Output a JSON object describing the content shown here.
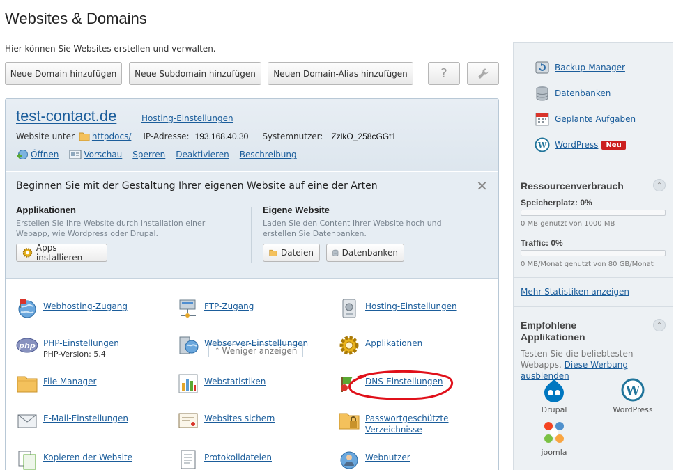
{
  "page": {
    "title": "Websites & Domains",
    "intro": "Hier können Sie Websites erstellen und verwalten."
  },
  "toolbar": {
    "add_domain": "Neue Domain hinzufügen",
    "add_subdomain": "Neue Subdomain hinzufügen",
    "add_alias": "Neuen Domain-Alias hinzufügen",
    "help_icon": "?",
    "tools_icon": "wrench-icon"
  },
  "site": {
    "domain": "test-contact.de",
    "hosting_link": "Hosting-Einstellungen",
    "website_prefix": "Website unter",
    "docroot": "httpdocs/",
    "ip_label": "IP-Adresse:",
    "ip": "193.168.40.30",
    "user_label": "Systemnutzer:",
    "user": "ZzlkO_258cGGt1",
    "actions": [
      "Öffnen",
      "Vorschau",
      "Sperren",
      "Deaktivieren",
      "Beschreibung"
    ]
  },
  "start": {
    "title": "Beginnen Sie mit der Gestaltung Ihrer eigenen Website auf eine der Arten",
    "close": "✕",
    "apps_title": "Applikationen",
    "apps_desc": "Erstellen Sie Ihre Website durch Installation einer Webapp, wie Wordpress oder Drupal.",
    "apps_button": "Apps installieren",
    "own_title": "Eigene Website",
    "own_desc": "Laden Sie den Content Ihrer Website hoch und erstellen Sie Datenbanken.",
    "files_button": "Dateien",
    "db_button": "Datenbanken",
    "less": "Weniger anzeigen"
  },
  "grid": [
    {
      "label": "Webhosting-Zugang"
    },
    {
      "label": "FTP-Zugang"
    },
    {
      "label": "Hosting-Einstellungen"
    },
    {
      "label": "PHP-Einstellungen",
      "sub": "PHP-Version: 5.4"
    },
    {
      "label": "Webserver-Einstellungen"
    },
    {
      "label": "Applikationen"
    },
    {
      "label": "File Manager"
    },
    {
      "label": "Webstatistiken"
    },
    {
      "label": "DNS-Einstellungen"
    },
    {
      "label": "E-Mail-Einstellungen"
    },
    {
      "label": "Websites sichern"
    },
    {
      "label": "Passwortgeschützte",
      "label2": "Verzeichnisse"
    },
    {
      "label": "Kopieren der Website"
    },
    {
      "label": "Protokolldateien"
    },
    {
      "label": "Webnutzer"
    }
  ],
  "sidebar": {
    "links": [
      {
        "label": "Backup-Manager"
      },
      {
        "label": "Datenbanken"
      },
      {
        "label": "Geplante Aufgaben"
      },
      {
        "label": "WordPress",
        "badge": "Neu"
      }
    ],
    "resources": {
      "title": "Ressourcenverbrauch",
      "disk_label": "Speicherplatz: 0%",
      "disk_fraction": 0.0,
      "disk_note": "0 MB genutzt von 1000 MB",
      "traffic_label": "Traffic: 0%",
      "traffic_fraction": 0.0,
      "traffic_note": "0 MB/Monat genutzt von 80 GB/Monat",
      "more": "Mehr Statistiken anzeigen"
    },
    "recommended": {
      "title_line1": "Empfohlene",
      "title_line2": "Applikationen",
      "desc": "Testen Sie die beliebtesten",
      "desc2": "Webapps.",
      "hide_link": "Diese Werbung ausblenden",
      "apps": [
        "Drupal",
        "WordPress",
        "joomla"
      ]
    }
  },
  "colors": {
    "link": "#1b5d9b",
    "badge": "#cc1f1f",
    "highlight": "#e0101a"
  }
}
